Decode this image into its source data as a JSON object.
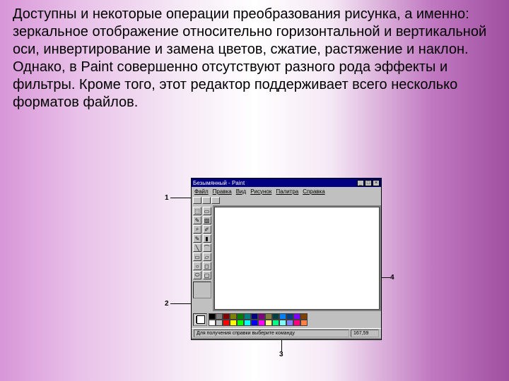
{
  "main_text": " Доступны и некоторые операции преобразования рисунка, а именно: зеркальное отображение относительно горизонтальной и вертикальной оси, инвертирование и замена цветов, сжатие, растяжение и наклон. Однако, в Paint совершенно отсутствуют разного рода эффекты и фильтры. Кроме того, этот редактор поддерживает всего несколько форматов файлов.",
  "window": {
    "title": "Безымянный - Paint",
    "menu": [
      "Файл",
      "Правка",
      "Вид",
      "Рисунок",
      "Палитра",
      "Справка"
    ],
    "status_hint": "Для получения справки выберите команду",
    "status_coords": "167,59"
  },
  "palette_colors": [
    "#000000",
    "#808080",
    "#800000",
    "#808000",
    "#008000",
    "#008080",
    "#000080",
    "#800080",
    "#808040",
    "#004040",
    "#0080ff",
    "#004080",
    "#8000ff",
    "#804000",
    "#ffffff",
    "#c0c0c0",
    "#ff0000",
    "#ffff00",
    "#00ff00",
    "#00ffff",
    "#0000ff",
    "#ff00ff",
    "#ffff80",
    "#00ff80",
    "#80ffff",
    "#8080ff",
    "#ff0080",
    "#ff8040"
  ],
  "tool_glyphs": [
    "⬚",
    "▭",
    "✎",
    "▨",
    "⌕",
    "✐",
    "✎",
    "▮",
    "╲",
    "⌒",
    "▭",
    "▱",
    "○",
    "◻",
    "⬭",
    "▢"
  ],
  "callouts": {
    "c1": "1",
    "c2": "2",
    "c3": "3",
    "c4": "4"
  }
}
